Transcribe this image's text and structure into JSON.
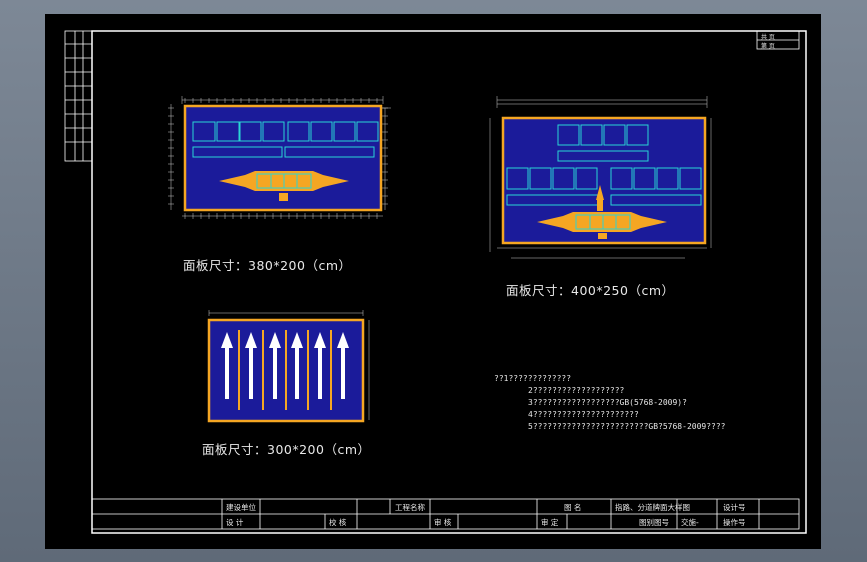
{
  "window": {
    "background": "#6f7a88"
  },
  "colors": {
    "frame": "#ffffff",
    "panel_border": "#f5a623",
    "cyan": "#2ad4d4",
    "blue": "#2b2bb8",
    "arrow_white": "#ffffff"
  },
  "panels": [
    {
      "caption": "面板尺寸：380*200（cm）"
    },
    {
      "caption": "面板尺寸：400*250（cm）"
    },
    {
      "caption": "面板尺寸：300*200（cm）"
    }
  ],
  "notes": [
    "??1?????????????",
    "2???????????????????",
    "3??????????????????GB(5768-2009)?",
    "4??????????????????????",
    "5????????????????????????GB?5768-2009????"
  ],
  "title_block": {
    "row1": {
      "designer_unit": "建设单位",
      "project_name": "工程名称",
      "drawing_label": "图  名",
      "drawing_name": "指路、分道牌面大样图",
      "design_no_label": "设计号"
    },
    "row2": {
      "design": "设  计",
      "check": "校  核",
      "review": "审  核",
      "approve": "审  定",
      "drawing_no_label": "图别图号",
      "drawing_no": "交施-",
      "sheet_label": "操作号"
    }
  },
  "corner_box": {
    "line1": "共  页",
    "line2": "第  页"
  }
}
